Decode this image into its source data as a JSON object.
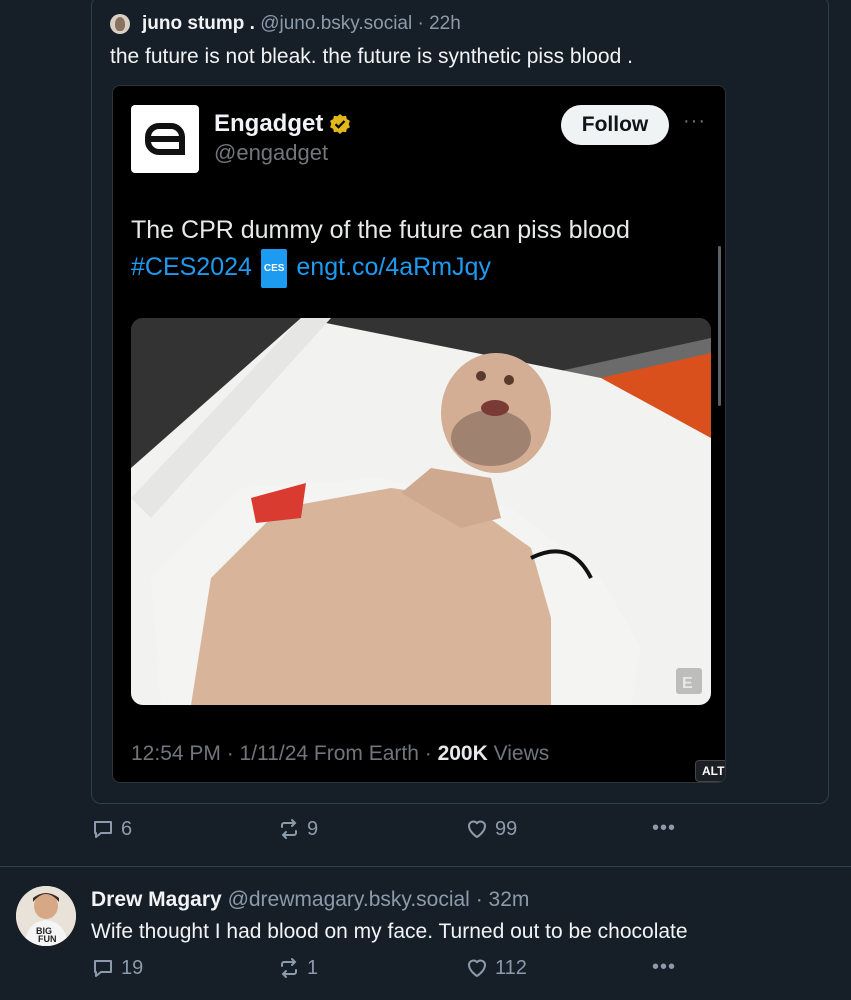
{
  "quote_post": {
    "author_name": "juno stump .",
    "author_handle": "@juno.bsky.social",
    "age": "· 22h",
    "text": "the future is not bleak. the future is synthetic piss blood .",
    "embed": {
      "account_name": "Engadget",
      "account_handle": "@engadget",
      "follow_label": "Follow",
      "more_label": "···",
      "body_text": "The CPR dummy of the future can piss blood",
      "hashtag": "#CES2024",
      "hashtag_emoji": "CES",
      "link": "engt.co/4aRmJqy",
      "meta_time": "12:54 PM · 1/11/24 From Earth · ",
      "meta_views_count": "200K",
      "meta_views_label": " Views",
      "image_alt_badge": "ALT",
      "image_watermark": "E"
    },
    "actions": {
      "reply_count": "6",
      "repost_count": "9",
      "like_count": "99",
      "more_label": "•••"
    }
  },
  "reply_post": {
    "author_name": "Drew Magary",
    "author_handle": "@drewmagary.bsky.social",
    "age": "· 32m",
    "text": "Wife thought I had blood on my face. Turned out to be chocolate",
    "avatar_shirt_text_1": "BIG",
    "avatar_shirt_text_2": "FUN",
    "actions": {
      "reply_count": "19",
      "repost_count": "1",
      "like_count": "112",
      "more_label": "•••"
    }
  },
  "colors": {
    "background": "#161e27",
    "border": "#2e4052",
    "muted_text": "#8c9bab",
    "link": "#1d9bf0"
  }
}
